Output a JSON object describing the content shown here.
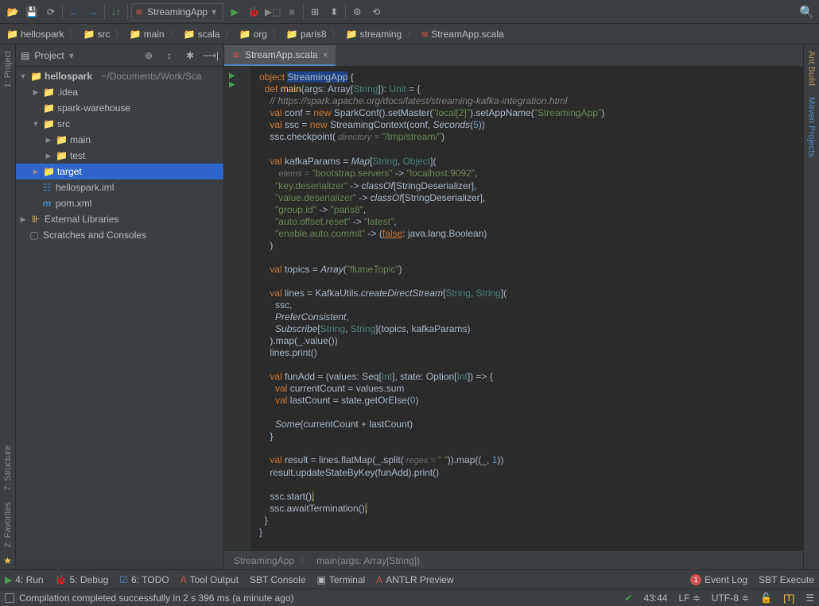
{
  "toolbar": {
    "run_config": "StreamingApp"
  },
  "breadcrumbs": [
    "hellospark",
    "src",
    "main",
    "scala",
    "org",
    "paris8",
    "streaming",
    "StreamApp.scala"
  ],
  "projectPanel": {
    "title": "Project"
  },
  "tree": {
    "root": {
      "name": "hellospark",
      "path": "~/Documents/Work/Sca"
    },
    "idea": ".idea",
    "warehouse": "spark-warehouse",
    "src": "src",
    "main": "main",
    "test": "test",
    "target": "target",
    "iml": "hellospark.iml",
    "pom": "pom.xml",
    "ext": "External Libraries",
    "scratch": "Scratches and Consoles"
  },
  "tab": {
    "name": "StreamApp.scala"
  },
  "footerBc": {
    "a": "StreamingApp",
    "b": "main(args: Array[String])"
  },
  "bottomBar": {
    "run": "4: Run",
    "debug": "5: Debug",
    "todo": "6: TODO",
    "tool": "Tool Output",
    "sbt": "SBT Console",
    "term": "Terminal",
    "antlr": "ANTLR Preview",
    "event": "Event Log",
    "sbte": "SBT Execute",
    "events": "1"
  },
  "status": {
    "msg": "Compilation completed successfully in 2 s 396 ms (a minute ago)",
    "pos": "43:44",
    "le": "LF",
    "enc": "UTF-8"
  },
  "leftGutter": [
    "1: Project"
  ],
  "leftGutterBottom": [
    "7: Structure",
    "2: Favorites"
  ],
  "rightGutter": [
    "Ant Build",
    "Maven Projects"
  ],
  "code": {
    "l1a": "object ",
    "l1b": "StreamingApp",
    "l1c": " {",
    "l2a": "  def ",
    "l2b": "main",
    "l2c": "(args: Array[",
    "l2d": "String",
    "l2e": "]): ",
    "l2f": "Unit",
    "l2g": " = {",
    "l3": "    // https://spark.apache.org/docs/latest/streaming-kafka-integration.html",
    "l4a": "    val ",
    "l4b": "conf",
    "l4c": " = ",
    "l4d": "new ",
    "l4e": "SparkConf().setMaster(",
    "l4f": "\"local[2]\"",
    "l4g": ").setAppName(",
    "l4h": "\"StreamingApp\"",
    "l4i": ")",
    "l5a": "    val ",
    "l5b": "ssc",
    "l5c": " = ",
    "l5d": "new ",
    "l5e": "StreamingContext(conf, ",
    "l5f": "Seconds",
    "l5g": "(",
    "l5h": "5",
    "l5i": "))",
    "l6a": "    ssc.checkpoint(",
    "l6h": " directory = ",
    "l6b": "\"/tmp/stream/\"",
    "l6c": ")",
    "l7": " ",
    "l8a": "    val ",
    "l8b": "kafkaParams",
    "l8c": " = ",
    "l8d": "Map",
    "l8e": "[",
    "l8f": "String",
    "l8g": ", ",
    "l8h": "Object",
    "l8i": "](",
    "l9h": "        elems = ",
    "l9a": "\"bootstrap.servers\"",
    "l9b": " -> ",
    "l9c": "\"localhost:9092\"",
    "l9d": ",",
    "l10a": "      \"key.deserializer\"",
    "l10b": " -> ",
    "l10c": "classOf",
    "l10d": "[StringDeserializer],",
    "l11a": "      \"value.deserializer\"",
    "l11b": " -> ",
    "l11c": "classOf",
    "l11d": "[StringDeserializer],",
    "l12a": "      \"group.id\"",
    "l12b": " -> ",
    "l12c": "\"paris8\"",
    "l12d": ",",
    "l13a": "      \"auto.offset.reset\"",
    "l13b": " -> ",
    "l13c": "\"latest\"",
    "l13d": ",",
    "l14a": "      \"enable.auto.commit\"",
    "l14b": " -> (",
    "l14c": "false",
    "l14d": ": java.lang.Boolean)",
    "l15": "    )",
    "l16": " ",
    "l17a": "    val ",
    "l17b": "topics",
    "l17c": " = ",
    "l17d": "Array",
    "l17e": "(",
    "l17f": "\"flumeTopic\"",
    "l17g": ")",
    "l18": " ",
    "l19a": "    val ",
    "l19b": "lines",
    "l19c": " = KafkaUtils.",
    "l19d": "createDirectStream",
    "l19e": "[",
    "l19f": "String",
    "l19g": ", ",
    "l19h": "String",
    "l19i": "](",
    "l20": "      ssc,",
    "l21a": "      ",
    "l21b": "PreferConsistent",
    "l21c": ",",
    "l22a": "      ",
    "l22b": "Subscribe",
    "l22c": "[",
    "l22d": "String",
    "l22e": ", ",
    "l22f": "String",
    "l22g": "](topics, kafkaParams)",
    "l23": "    ).map(_.value())",
    "l24": "    lines.print()",
    "l25": " ",
    "l26a": "    val ",
    "l26b": "funAdd",
    "l26c": " = (values: Seq[",
    "l26d": "Int",
    "l26e": "], state: Option[",
    "l26f": "Int",
    "l26g": "]) => {",
    "l27a": "      val ",
    "l27b": "currentCount",
    "l27c": " = values.sum",
    "l28a": "      val ",
    "l28b": "lastCount",
    "l28c": " = state.getOrElse(",
    "l28d": "0",
    "l28e": ")",
    "l29": " ",
    "l30a": "      ",
    "l30b": "Some",
    "l30c": "(currentCount + lastCount)",
    "l31": "    }",
    "l32": " ",
    "l33a": "    val ",
    "l33b": "result",
    "l33c": " = lines.flatMap(_.split(",
    "l33h": " regex = ",
    "l33d": "\" \"",
    "l33e": ")).map((_, ",
    "l33f": "1",
    "l33g": "))",
    "l34": "    result.updateStateByKey(funAdd).print()",
    "l35": " ",
    "l36": "    ssc.start()",
    "l37": "    ssc.awaitTermination()",
    "l38": "  }",
    "l39": "}"
  }
}
